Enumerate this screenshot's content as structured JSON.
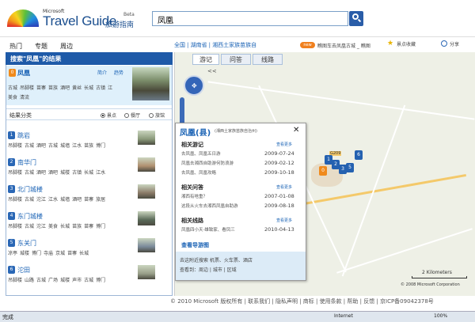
{
  "brand": {
    "ms": "Microsoft",
    "name": "Travel Guide",
    "cn": "旅游指南",
    "beta": "Beta"
  },
  "search": {
    "value": "凤凰"
  },
  "nav": {
    "items": [
      "热门",
      "专题",
      "周边"
    ]
  },
  "breadcrumb": [
    "全国",
    "湖南省",
    "湘西土家族苗族自"
  ],
  "topbar": {
    "new_badge": "new",
    "new_text": "瞧图车去凤凰古城 _ 瞧图",
    "favorite": "景点收藏",
    "share": "分享"
  },
  "left": {
    "header": "搜索\"凤凰\"的结果",
    "top_result": {
      "pin": "0",
      "title": "凤凰",
      "tab_intro": "简介",
      "tab_trend": "趋势",
      "tags_row1": [
        "古城",
        "吊脚楼",
        "苗寨",
        "苗族",
        "酒吧",
        "黄丝",
        "长城",
        "古镇",
        "江"
      ],
      "tags_row2": [
        "美食",
        "清流"
      ]
    },
    "category": {
      "label": "结果分类",
      "options": [
        "景点",
        "餐厅",
        "旅馆"
      ]
    },
    "items": [
      {
        "num": "1",
        "title": "跳岩",
        "tags": [
          "吊脚楼",
          "古城",
          "酒吧",
          "古城",
          "城墙",
          "江水",
          "苗族",
          "博门"
        ]
      },
      {
        "num": "2",
        "title": "南华门",
        "tags": [
          "吊脚楼",
          "古城",
          "酒吧",
          "酒吧",
          "城楼",
          "古镇",
          "长城",
          "江水"
        ]
      },
      {
        "num": "3",
        "title": "北门城楼",
        "tags": [
          "吊脚楼",
          "古城",
          "沱江",
          "江水",
          "城墙",
          "酒吧",
          "苗寨",
          "旅居"
        ]
      },
      {
        "num": "4",
        "title": "东门城楼",
        "tags": [
          "吊脚楼",
          "古城",
          "沱江",
          "美食",
          "长城",
          "苗族",
          "苗寨",
          "博门"
        ]
      },
      {
        "num": "5",
        "title": "东关门",
        "tags": [
          "凉亭",
          "城楼",
          "博门",
          "寺庙",
          "京城",
          "苗寨",
          "长城"
        ]
      },
      {
        "num": "6",
        "title": "沱田",
        "tags": [
          "吊脚楼",
          "山路",
          "古城",
          "广场",
          "城楼",
          "声市",
          "古城",
          "博门"
        ]
      }
    ]
  },
  "map": {
    "tabs": [
      "游记",
      "问答",
      "线路"
    ],
    "collapse": "<<",
    "scale": "2 Kilometers",
    "copyright": "© 2008 Microsoft Corporation",
    "road_label": "G209",
    "markers": [
      "1",
      "2",
      "3",
      "5",
      "6"
    ]
  },
  "popup": {
    "title": "凤凰(县)",
    "subtitle": "(湘西土家族苗族自治州)",
    "close": "✕",
    "sections": [
      {
        "title": "相关游记",
        "more": "查看更多",
        "rows": [
          {
            "text": "去凤凰、凤凰五日游",
            "date": "2009-07-24"
          },
          {
            "text": "凤凰去湘西自助游何防浪游",
            "date": "2009-02-12"
          },
          {
            "text": "去凤凰、凤凰攻略",
            "date": "2009-10-18"
          }
        ]
      },
      {
        "title": "相关问答",
        "more": "查看更多",
        "rows": [
          {
            "text": "湘西有啥重？",
            "date": "2007-01-08"
          },
          {
            "text": "这段从火车去湘西凤凰自助游",
            "date": "2009-08-18"
          }
        ]
      },
      {
        "title": "相关线路",
        "more": "查看更多",
        "rows": [
          {
            "text": "凤凰四小天·雄致家、看凤三",
            "date": "2010-04-13"
          }
        ]
      }
    ],
    "guide_link": "查看导游图",
    "foot1": "去这附近搜索 机票、火车票、酒店",
    "foot2": "查看到：周边 | 城市 | 区域"
  },
  "footer": "© 2010 Microsoft 版权所有 | 联系我们 | 隐私声明 | 商标 | 使用条款 | 帮助 | 反馈 | 京ICP备09042378号",
  "status": {
    "left": "完成",
    "zone": "Internet",
    "zoom": "100%"
  }
}
